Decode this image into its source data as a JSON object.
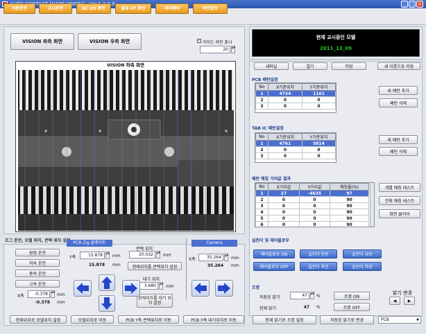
{
  "window": {
    "title": "AUTO CONTACT [NAIM VISION] - Ver.1.2.0.0",
    "min": "_",
    "max": "□",
    "close": "×"
  },
  "menu": [
    "자동운전",
    "교시운전",
    "AC I/O 확인",
    "물류 I/F 확인",
    "파라메터",
    "버전정보"
  ],
  "vision_buttons": {
    "left": "VISION 좌측 화면",
    "right": "VISION 우측 화면"
  },
  "guide": {
    "label": "가이드 라인 표시",
    "checked": true,
    "value": "20"
  },
  "viewer_title": "VISION 좌측 화면",
  "model": {
    "title": "현재 교시중인 모델",
    "name": "2011_12_09"
  },
  "file_buttons": [
    "새파일",
    "열기",
    "저장",
    "새 이름으로 저장"
  ],
  "pcb_pattern": {
    "title": "PCB 패턴설정",
    "headers": [
      "No",
      "X기준위치",
      "Y기준위치"
    ],
    "rows": [
      [
        "1",
        "4734",
        "1161"
      ],
      [
        "2",
        "0",
        "0"
      ],
      [
        "3",
        "0",
        "0"
      ]
    ],
    "add": "새 패턴 추가",
    "delete": "패턴 삭제"
  },
  "tab_pattern": {
    "title": "TAB IC 패턴설정",
    "headers": [
      "No",
      "X기준위치",
      "Y기준위치"
    ],
    "rows": [
      [
        "1",
        "4761",
        "5814"
      ],
      [
        "2",
        "0",
        "0"
      ],
      [
        "3",
        "0",
        "0"
      ]
    ],
    "add": "새 패턴 추가",
    "delete": "패턴 삭제"
  },
  "matching": {
    "title": "패턴 매칭 거리값 결과",
    "headers": [
      "No",
      "X거리값",
      "Y거리값",
      "매칭율(%)"
    ],
    "rows": [
      [
        "1",
        "27",
        "-4635",
        "97"
      ],
      [
        "2",
        "0",
        "0",
        "90"
      ],
      [
        "3",
        "0",
        "0",
        "90"
      ],
      [
        "4",
        "0",
        "0",
        "90"
      ],
      [
        "5",
        "0",
        "0",
        "90"
      ],
      [
        "6",
        "0",
        "0",
        "90"
      ]
    ],
    "btn1": "개별 매칭 테스트",
    "btn2": "전체 매칭 테스트",
    "btn3": "화면 클리어"
  },
  "cylinder": {
    "title": "실린더 및 에어블로우",
    "air_on": "에어블로우 ON",
    "cyl_fwd": "실린더 전진",
    "cyl_up": "실린더 상승",
    "air_off": "에어블로우 OFF",
    "cyl_back": "실린더 후진",
    "cyl_down": "실린더 하강"
  },
  "light": {
    "title": "조명",
    "saved_label": "저장된 밝기",
    "saved_value": "47",
    "unit": "%",
    "current_label": "현재 밝기",
    "current_value": "47",
    "on": "조명 ON",
    "off": "조명 OFF",
    "set_current": "현재 밝기로 조명 설정",
    "change_saved": "저장된 밝기로 변경",
    "range_title": "밝기 변경",
    "left": "◀",
    "right": "▶",
    "select": "PCB"
  },
  "bottom_title": "조그 운전, 모델 위치, 콘택 위치 설정",
  "speeds": [
    "원점 운전",
    "저속 운전",
    "중속 운전",
    "고속 운전"
  ],
  "pcb_zig": {
    "title": "PCB Zig 클레이트",
    "y_label": "Y축",
    "y_value": "15.878",
    "y_current": "15.878",
    "unit": "mm"
  },
  "contact": {
    "label": "콘택 위치",
    "value": "20.032",
    "set_btn": "현재위치를 콘택위치 설정"
  },
  "wait": {
    "label": "대기 위치",
    "value": "3.680",
    "btn": "현재위치를 대기 위치 설정"
  },
  "x_axis": {
    "label": "X축",
    "value": "-0.378",
    "current": "-0.378",
    "unit": "mm"
  },
  "camera": {
    "title": "Camera",
    "x_label": "X축",
    "x_value": "35.264",
    "x_current": "35.264",
    "unit": "mm"
  },
  "bottom_buttons": [
    "현재위치로 모델위치 설정",
    "모델위치로 이동",
    "PCB Y축 콘택위치로 이동",
    "PCB Y축 대기위치로 이동"
  ],
  "colors": {
    "title_bg": "#2a55b0",
    "menu_btn": "#e79a1e",
    "selected_row": "#4a6fd0",
    "model_bg": "#000000",
    "model_text": "#22cc22"
  }
}
